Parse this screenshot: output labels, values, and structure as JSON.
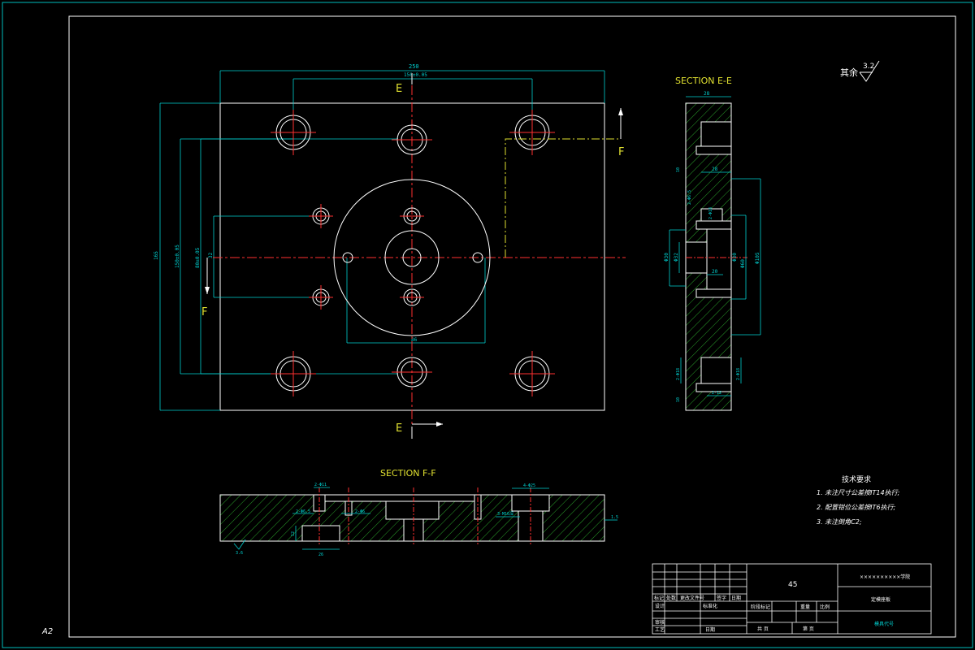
{
  "sheet": {
    "size_label": "A2",
    "surface_mark": "其余",
    "surface_roughness": "3.2"
  },
  "main_view": {
    "section_mark_e_top": "E",
    "section_mark_e_bottom": "E",
    "section_mark_f_right": "F",
    "section_mark_f_left": "F",
    "dim_top_overall": "250",
    "dim_top_holes": "150±0.05",
    "dim_left_overall": "165",
    "dim_left_holes1": "150±0.05",
    "dim_left_holes2": "80±0.05",
    "dim_left_small": "32",
    "dim_bottom_circle": "86"
  },
  "section_ee": {
    "title": "SECTION E-E",
    "dim_top": "28",
    "dim_mid": "28",
    "dim_phi1": "Φ30",
    "dim_phi2": "Φ32",
    "dim_phi3": "Φ30",
    "dim_phi4": "Φ105",
    "dim_phi5": "Φ60",
    "dim_depth": "20",
    "dim_holes_top": "2-Φ6.5",
    "dim_holes_bottom": "2-Φ18",
    "dim_hole_lr": "2-Φ18",
    "dim_side_a": "10",
    "dim_side_b": "10",
    "dim_bot_depth": "2-12"
  },
  "section_ff": {
    "title": "SECTION F-F",
    "dim_hole_a": "2-Φ11",
    "dim_hole_b": "2-Φ6.5",
    "dim_hole_c": "2-Φ6",
    "dim_hole_d": "4-Φ25",
    "dim_hole_e": "3-M16深",
    "dim_bottom": "26",
    "dim_height": "12",
    "dim_right": "1.5",
    "dim_rough": "3.6"
  },
  "tech_requirements": {
    "title": "技术要求",
    "items": [
      "1. 未注尺寸公差按IT14执行;",
      "2. 配置钳位公差按IT6执行;",
      "3. 未注倒角C2;"
    ]
  },
  "title_block": {
    "material": "45",
    "school": "××××××××××学院",
    "part_name": "定模座板",
    "drawing_no": "模具代号",
    "col_mark": "标记",
    "col_count": "处数",
    "col_zone": "更改文件号",
    "col_sign": "签字",
    "col_date": "日期",
    "row_design": "设计",
    "row_standard": "标准化",
    "row_stage": "阶段标记",
    "row_weight": "重量",
    "row_scale": "比例",
    "row_review": "审核",
    "row_process": "工艺",
    "row_approve": "日期",
    "row_total": "共 页",
    "row_sheet": "第 页"
  }
}
